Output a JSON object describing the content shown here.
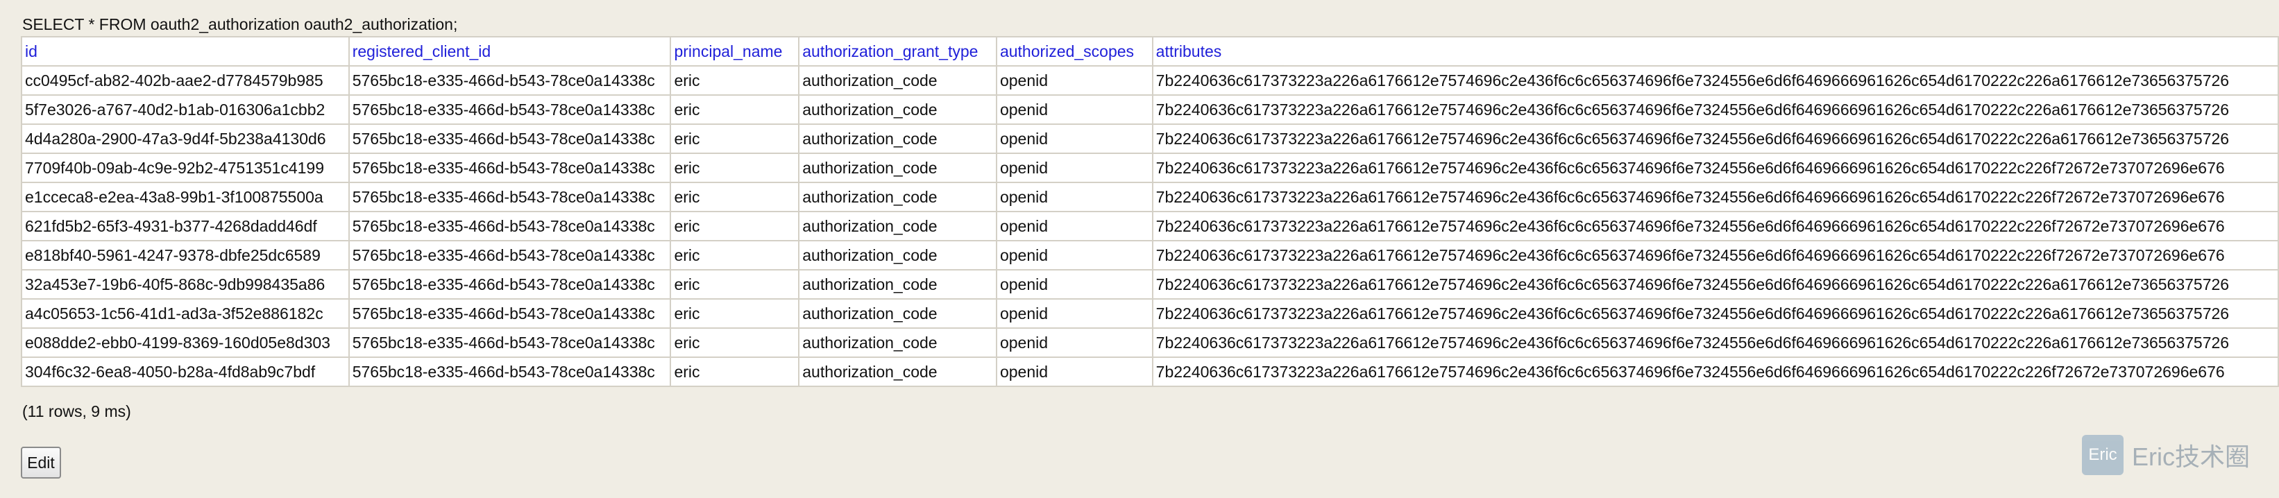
{
  "query": "SELECT * FROM oauth2_authorization oauth2_authorization;",
  "table": {
    "columns": [
      "id",
      "registered_client_id",
      "principal_name",
      "authorization_grant_type",
      "authorized_scopes",
      "attributes"
    ],
    "rows": [
      [
        "cc0495cf-ab82-402b-aae2-d7784579b985",
        "5765bc18-e335-466d-b543-78ce0a14338c",
        "eric",
        "authorization_code",
        "openid",
        "7b2240636c617373223a226a6176612e7574696c2e436f6c6c656374696f6e7324556e6d6f6469666961626c654d6170222c226a6176612e73656375726"
      ],
      [
        "5f7e3026-a767-40d2-b1ab-016306a1cbb2",
        "5765bc18-e335-466d-b543-78ce0a14338c",
        "eric",
        "authorization_code",
        "openid",
        "7b2240636c617373223a226a6176612e7574696c2e436f6c6c656374696f6e7324556e6d6f6469666961626c654d6170222c226a6176612e73656375726"
      ],
      [
        "4d4a280a-2900-47a3-9d4f-5b238a4130d6",
        "5765bc18-e335-466d-b543-78ce0a14338c",
        "eric",
        "authorization_code",
        "openid",
        "7b2240636c617373223a226a6176612e7574696c2e436f6c6c656374696f6e7324556e6d6f6469666961626c654d6170222c226a6176612e73656375726"
      ],
      [
        "7709f40b-09ab-4c9e-92b2-4751351c4199",
        "5765bc18-e335-466d-b543-78ce0a14338c",
        "eric",
        "authorization_code",
        "openid",
        "7b2240636c617373223a226a6176612e7574696c2e436f6c6c656374696f6e7324556e6d6f6469666961626c654d6170222c226f72672e737072696e676"
      ],
      [
        "e1cceca8-e2ea-43a8-99b1-3f100875500a",
        "5765bc18-e335-466d-b543-78ce0a14338c",
        "eric",
        "authorization_code",
        "openid",
        "7b2240636c617373223a226a6176612e7574696c2e436f6c6c656374696f6e7324556e6d6f6469666961626c654d6170222c226f72672e737072696e676"
      ],
      [
        "621fd5b2-65f3-4931-b377-4268dadd46df",
        "5765bc18-e335-466d-b543-78ce0a14338c",
        "eric",
        "authorization_code",
        "openid",
        "7b2240636c617373223a226a6176612e7574696c2e436f6c6c656374696f6e7324556e6d6f6469666961626c654d6170222c226f72672e737072696e676"
      ],
      [
        "e818bf40-5961-4247-9378-dbfe25dc6589",
        "5765bc18-e335-466d-b543-78ce0a14338c",
        "eric",
        "authorization_code",
        "openid",
        "7b2240636c617373223a226a6176612e7574696c2e436f6c6c656374696f6e7324556e6d6f6469666961626c654d6170222c226f72672e737072696e676"
      ],
      [
        "32a453e7-19b6-40f5-868c-9db998435a86",
        "5765bc18-e335-466d-b543-78ce0a14338c",
        "eric",
        "authorization_code",
        "openid",
        "7b2240636c617373223a226a6176612e7574696c2e436f6c6c656374696f6e7324556e6d6f6469666961626c654d6170222c226a6176612e73656375726"
      ],
      [
        "a4c05653-1c56-41d1-ad3a-3f52e886182c",
        "5765bc18-e335-466d-b543-78ce0a14338c",
        "eric",
        "authorization_code",
        "openid",
        "7b2240636c617373223a226a6176612e7574696c2e436f6c6c656374696f6e7324556e6d6f6469666961626c654d6170222c226a6176612e73656375726"
      ],
      [
        "e088dde2-ebb0-4199-8369-160d05e8d303",
        "5765bc18-e335-466d-b543-78ce0a14338c",
        "eric",
        "authorization_code",
        "openid",
        "7b2240636c617373223a226a6176612e7574696c2e436f6c6c656374696f6e7324556e6d6f6469666961626c654d6170222c226a6176612e73656375726"
      ],
      [
        "304f6c32-6ea8-4050-b28a-4fd8ab9c7bdf",
        "5765bc18-e335-466d-b543-78ce0a14338c",
        "eric",
        "authorization_code",
        "openid",
        "7b2240636c617373223a226a6176612e7574696c2e436f6c6c656374696f6e7324556e6d6f6469666961626c654d6170222c226f72672e737072696e676"
      ]
    ]
  },
  "status": "(11 rows, 9 ms)",
  "buttons": {
    "edit_label": "Edit"
  },
  "watermark": {
    "logo_text": "Eric",
    "text": "Eric技术圈"
  },
  "colors": {
    "background": "#f0ede4",
    "header_text": "#1f1fd9",
    "grid_border": "#d4d0c6"
  }
}
